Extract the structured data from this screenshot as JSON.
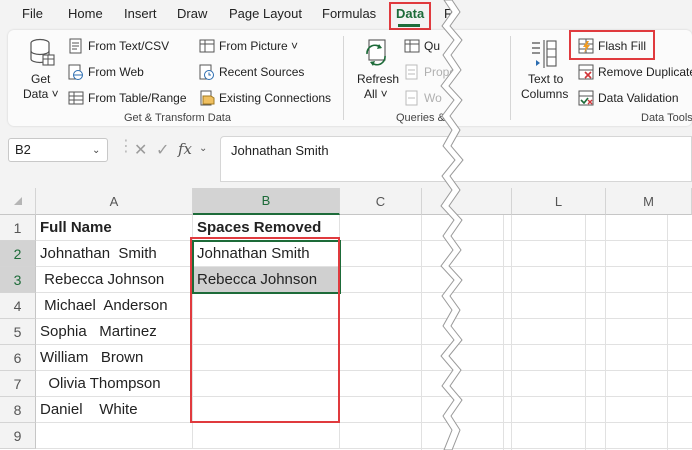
{
  "menu": {
    "tabs": [
      "File",
      "Home",
      "Insert",
      "Draw",
      "Page Layout",
      "Formulas",
      "Data",
      "R"
    ],
    "active": "Data"
  },
  "ribbon": {
    "get_data": {
      "line1": "Get",
      "line2": "Data ˅"
    },
    "from_text_csv": "From Text/CSV",
    "from_web": "From Web",
    "from_table_range": "From Table/Range",
    "from_picture": "From Picture ˅",
    "recent_sources": "Recent Sources",
    "existing_connections": "Existing Connections",
    "group_get_transform": "Get & Transform Data",
    "refresh": {
      "line1": "Refresh",
      "line2": "All ˅"
    },
    "queries_partial": "Qu",
    "properties_partial": "Prope",
    "workbook_partial": "Wo",
    "group_queries": "Queries &",
    "text_to_columns": {
      "line1": "Text to",
      "line2": "Columns"
    },
    "flash_fill": "Flash Fill",
    "remove_duplicates": "Remove Duplicate",
    "data_validation": "Data Validation",
    "group_data_tools": "Data Tools"
  },
  "formula_bar": {
    "name_box": "B2",
    "fx": "fx",
    "content": "Johnathan Smith"
  },
  "grid": {
    "columns": [
      "A",
      "B",
      "C",
      "L",
      "M"
    ],
    "selected_column": "B",
    "rows": [
      "1",
      "2",
      "3",
      "4",
      "5",
      "6",
      "7",
      "8",
      "9"
    ],
    "col_a": [
      "Full Name",
      "Johnathan  Smith",
      " Rebecca Johnson",
      " Michael  Anderson",
      "Sophia   Martinez",
      "William   Brown",
      "  Olivia Thompson",
      "Daniel    White",
      ""
    ],
    "col_b": [
      "Spaces Removed",
      "Johnathan Smith",
      "Rebecca Johnson",
      "",
      "",
      "",
      "",
      "",
      ""
    ]
  },
  "colors": {
    "accent_green": "#1d6b39",
    "highlight_red": "#e03a3e"
  }
}
